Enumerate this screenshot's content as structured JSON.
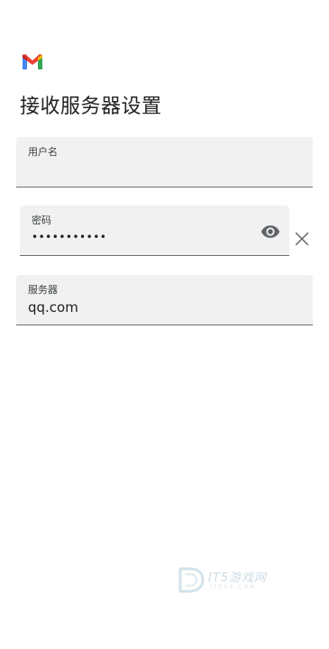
{
  "app": {
    "logo_icon": "gmail-m-logo-icon",
    "brand_colors": {
      "red": "#EA4335",
      "blue": "#4285F4",
      "green": "#34A853",
      "yellow": "#FBBC04"
    }
  },
  "page": {
    "title": "接收服务器设置"
  },
  "form": {
    "username": {
      "label": "用户名",
      "value": ""
    },
    "password": {
      "label": "密码",
      "value": "•••••••••••",
      "toggle_icon": "eye-icon",
      "clear_icon": "close-icon"
    },
    "server": {
      "label": "服务器",
      "value": "qq.com"
    }
  },
  "watermark": {
    "text": "IT5游戏网",
    "subtext": "ITSXX.COM"
  }
}
